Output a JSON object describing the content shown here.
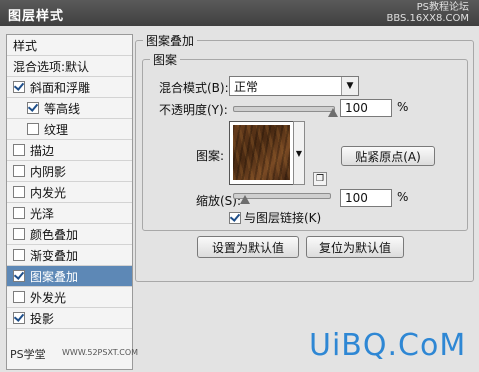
{
  "window": {
    "title": "图层样式",
    "watermark_top_line1": "PS教程论坛",
    "watermark_top_line2": "BBS.16XX8.COM"
  },
  "sidebar": {
    "items": [
      {
        "label": "样式",
        "checkbox": false
      },
      {
        "label": "混合选项:默认",
        "checkbox": false
      },
      {
        "label": "斜面和浮雕",
        "checkbox": true,
        "checked": true
      },
      {
        "label": "等高线",
        "checkbox": true,
        "checked": true,
        "indent": true
      },
      {
        "label": "纹理",
        "checkbox": true,
        "checked": false,
        "indent": true
      },
      {
        "label": "描边",
        "checkbox": true,
        "checked": false
      },
      {
        "label": "内阴影",
        "checkbox": true,
        "checked": false
      },
      {
        "label": "内发光",
        "checkbox": true,
        "checked": false
      },
      {
        "label": "光泽",
        "checkbox": true,
        "checked": false
      },
      {
        "label": "颜色叠加",
        "checkbox": true,
        "checked": false
      },
      {
        "label": "渐变叠加",
        "checkbox": true,
        "checked": false
      },
      {
        "label": "图案叠加",
        "checkbox": true,
        "checked": true,
        "selected": true
      },
      {
        "label": "外发光",
        "checkbox": true,
        "checked": false
      },
      {
        "label": "投影",
        "checkbox": true,
        "checked": true
      }
    ]
  },
  "panel": {
    "group_title": "图案叠加",
    "section_title": "图案",
    "blend_mode_label": "混合模式(B):",
    "blend_mode_value": "正常",
    "opacity_label": "不透明度(Y):",
    "opacity_value": "100",
    "opacity_unit": "%",
    "opacity_level": 1.0,
    "pattern_label": "图案:",
    "pattern_icon": "wood-texture",
    "snap_origin_button": "贴紧原点(A)",
    "scale_label": "缩放(S):",
    "scale_value": "100",
    "scale_unit": "%",
    "scale_level": 0.13,
    "link_layer_label": "与图层链接(K)",
    "link_layer_checked": true,
    "set_default_button": "设置为默认值",
    "reset_default_button": "复位为默认值"
  },
  "watermarks": {
    "bottom_left": "PS学堂",
    "bottom_mid": "WWW.52PSXT.COM",
    "bottom_right": "UiBQ.CoM"
  },
  "colors": {
    "selection": "#5d88b6",
    "watermark_blue": "#2e87d4"
  }
}
